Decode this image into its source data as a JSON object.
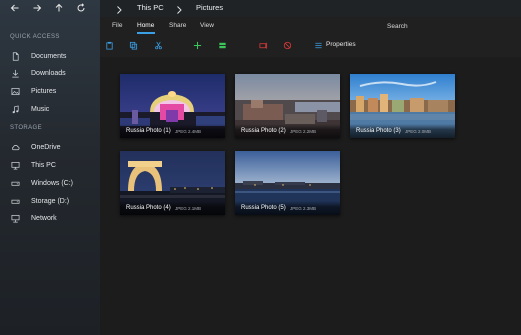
{
  "nav": {
    "back_icon": "arrow-left-icon",
    "forward_icon": "arrow-right-icon",
    "up_icon": "arrow-up-icon",
    "refresh_icon": "refresh-icon"
  },
  "breadcrumb": {
    "items": [
      "This PC",
      "Pictures"
    ]
  },
  "ribbon": {
    "tabs": [
      "File",
      "Home",
      "Share",
      "View"
    ],
    "active_tab": "Home",
    "search_label": "Search",
    "properties_label": "Properties",
    "accent_color": "#3b9fe6",
    "tool_icons": [
      "paste-icon",
      "copy-icon",
      "cut-icon",
      "new-item-icon",
      "select-icon",
      "rename-icon",
      "delete-icon",
      "properties-icon"
    ]
  },
  "sidebar": {
    "quick_access_title": "QUICK ACCESS",
    "quick_access": [
      {
        "label": "Documents",
        "icon": "document-icon"
      },
      {
        "label": "Downloads",
        "icon": "download-icon"
      },
      {
        "label": "Pictures",
        "icon": "picture-icon"
      },
      {
        "label": "Music",
        "icon": "music-icon"
      }
    ],
    "storage_title": "STORAGE",
    "storage": [
      {
        "label": "OneDrive",
        "icon": "cloud-icon"
      },
      {
        "label": "This PC",
        "icon": "computer-icon"
      },
      {
        "label": "Windows (C:)",
        "icon": "drive-icon"
      },
      {
        "label": "Storage (D:)",
        "icon": "drive-icon"
      },
      {
        "label": "Network",
        "icon": "network-icon"
      }
    ]
  },
  "files": [
    {
      "name": "Russia Photo (1)",
      "size": "JPEG 2.4MB"
    },
    {
      "name": "Russia Photo (2)",
      "size": "JPEG 2.2MB"
    },
    {
      "name": "Russia Photo (3)",
      "size": "JPEG 2.0MB"
    },
    {
      "name": "Russia Photo (4)",
      "size": "JPEG 2.1MB"
    },
    {
      "name": "Russia Photo (5)",
      "size": "JPEG 2.3MB"
    }
  ]
}
